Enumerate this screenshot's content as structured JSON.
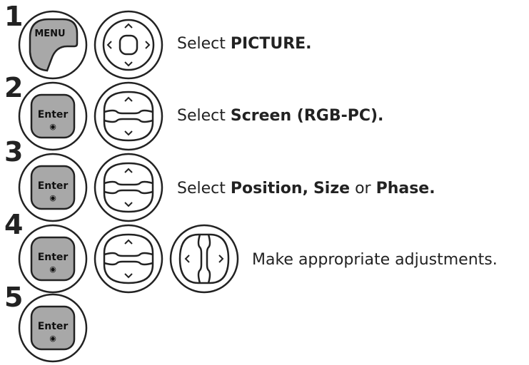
{
  "steps": [
    {
      "number": "1",
      "buttons": [
        "menu-key",
        "nav-pad-4way"
      ],
      "text": {
        "prefix": "Select ",
        "bold1": "PICTURE.",
        "mid": "",
        "bold2": "",
        "mid2": "",
        "bold3": ""
      }
    },
    {
      "number": "2",
      "buttons": [
        "enter-key",
        "nav-pad-updown"
      ],
      "text": {
        "prefix": "Select ",
        "bold1": "Screen (RGB-PC).",
        "mid": "",
        "bold2": "",
        "mid2": "",
        "bold3": ""
      }
    },
    {
      "number": "3",
      "buttons": [
        "enter-key",
        "nav-pad-updown"
      ],
      "text": {
        "prefix": "Select ",
        "bold1": "Position,",
        "mid": " ",
        "bold2": "Size",
        "mid2": " or ",
        "bold3": "Phase."
      }
    },
    {
      "number": "4",
      "buttons": [
        "enter-key",
        "nav-pad-updown",
        "nav-pad-leftright"
      ],
      "text": {
        "prefix": "Make appropriate adjustments.",
        "bold1": "",
        "mid": "",
        "bold2": "",
        "mid2": "",
        "bold3": ""
      }
    },
    {
      "number": "5",
      "buttons": [
        "enter-key"
      ],
      "text": {
        "prefix": "",
        "bold1": "",
        "mid": "",
        "bold2": "",
        "mid2": "",
        "bold3": ""
      }
    }
  ],
  "keys": {
    "menu_label": "MENU",
    "enter_label": "Enter",
    "enter_dot": "◉"
  },
  "colors": {
    "key_fill": "#a8a8a8",
    "key_outline": "#222222",
    "text": "#222222"
  }
}
